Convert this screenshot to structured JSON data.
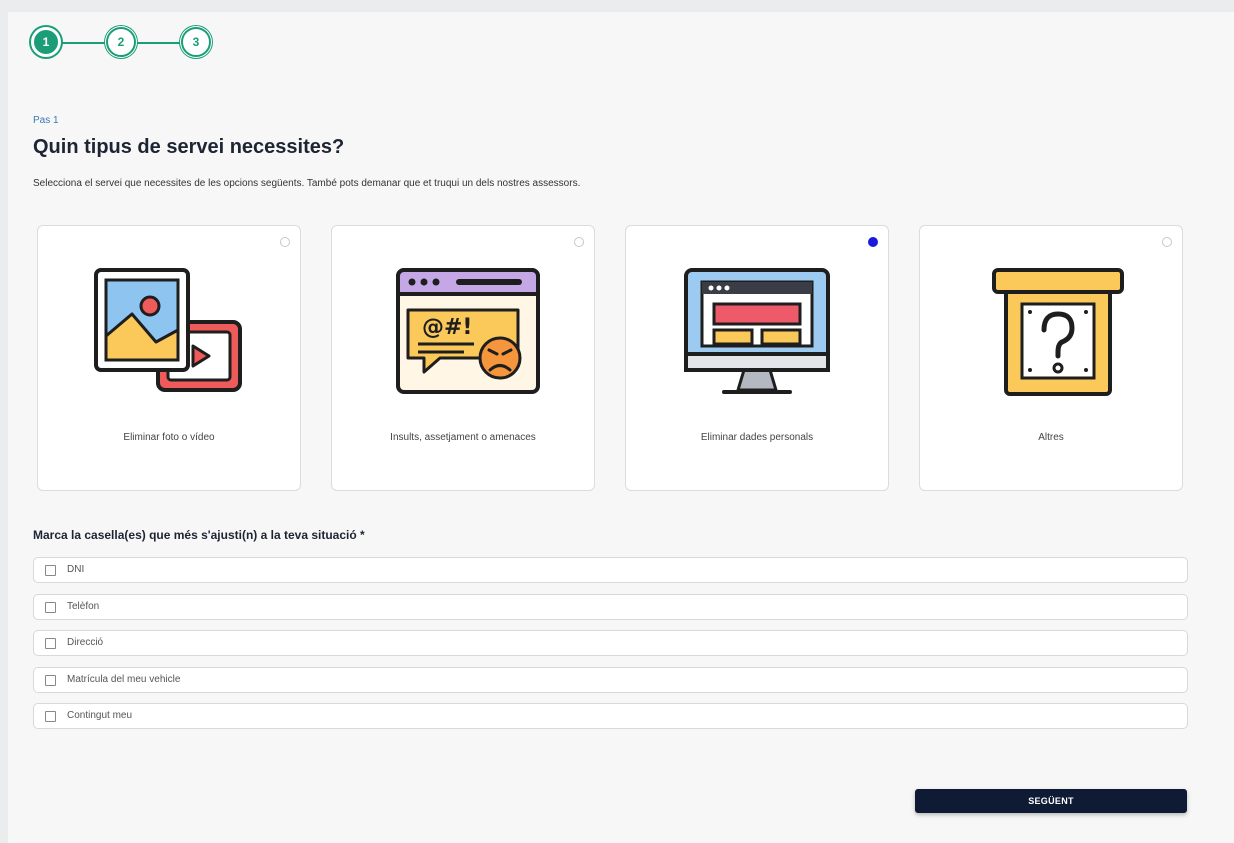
{
  "stepper": {
    "steps": [
      {
        "number": "1",
        "state": "active"
      },
      {
        "number": "2",
        "state": "pending"
      },
      {
        "number": "3",
        "state": "pending"
      }
    ],
    "color": "#1b9e77"
  },
  "header": {
    "step_label": "Pas 1",
    "title": "Quin tipus de servei necessites?",
    "subtitle": "Selecciona el servei que necessites de les opcions següents. També pots demanar que et truqui un dels nostres assessors."
  },
  "services": [
    {
      "label": "Eliminar foto o vídeo",
      "icon": "photo-video-icon",
      "selected": false
    },
    {
      "label": "Insults, assetjament o amenaces",
      "icon": "angry-message-icon",
      "selected": false
    },
    {
      "label": "Eliminar dades personals",
      "icon": "monitor-data-icon",
      "selected": true
    },
    {
      "label": "Altres",
      "icon": "question-box-icon",
      "selected": false
    }
  ],
  "question": {
    "label": "Marca la casella(es) que més s'ajusti(n) a la teva situació *"
  },
  "options": [
    {
      "label": "DNI",
      "checked": false
    },
    {
      "label": "Telèfon",
      "checked": false
    },
    {
      "label": "Direcció",
      "checked": false
    },
    {
      "label": "Matrícula del meu vehicle",
      "checked": false
    },
    {
      "label": "Contingut meu",
      "checked": false
    }
  ],
  "actions": {
    "next_label": "SEGÜENT"
  },
  "colors": {
    "radio_selected": "#1a1adb",
    "button_bg": "#0f1b35"
  }
}
